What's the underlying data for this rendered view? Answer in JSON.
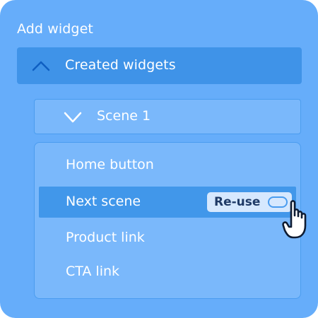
{
  "panel": {
    "title": "Add widget"
  },
  "section": {
    "label": "Created widgets",
    "state": "expanded",
    "chevron_icon": "chevron-up-icon"
  },
  "scene": {
    "label": "Scene 1",
    "state": "expanded",
    "chevron_icon": "chevron-down-icon"
  },
  "widgets": {
    "items": [
      {
        "label": "Home button"
      },
      {
        "label": "Next scene",
        "active": true
      },
      {
        "label": "Product link"
      },
      {
        "label": "CTA link"
      }
    ]
  },
  "reuse": {
    "label": "Re-use",
    "toggle_on": false
  },
  "colors": {
    "panel_bg": "#66adfa",
    "section_header_bg": "#3f93e8",
    "card_bg": "#7ab8fb",
    "active_row_bg": "#4197ea",
    "accent_dark": "#1f3a66"
  }
}
